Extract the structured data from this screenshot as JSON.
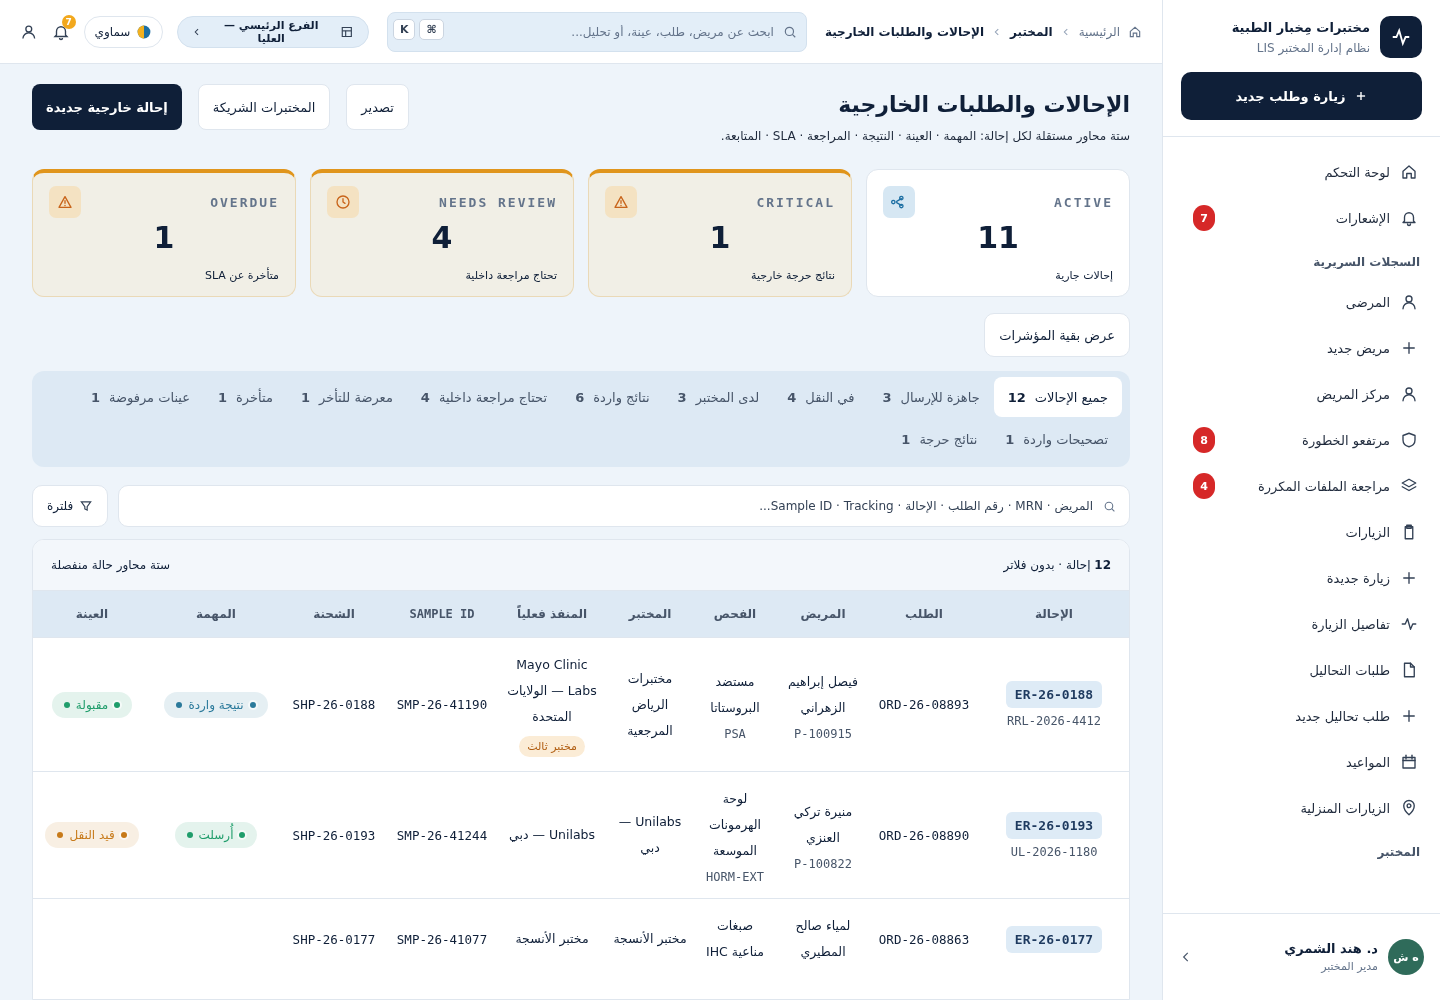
{
  "sidebar": {
    "brand": {
      "title": "مختبرات مِخبار الطبية",
      "subtitle": "نظام إدارة المختبر LIS"
    },
    "new_button": "زيارة وطلب جديد",
    "items": [
      {
        "kind": "link",
        "label": "لوحة التحكم",
        "selected": false
      },
      {
        "kind": "link",
        "label": "الإشعارات",
        "badge": "7",
        "selected": false
      },
      {
        "kind": "section",
        "label": "السجلات السريرية"
      },
      {
        "kind": "link",
        "label": "المرضى",
        "selected": false
      },
      {
        "kind": "link",
        "label": "مريض جديد",
        "selected": false
      },
      {
        "kind": "link",
        "label": "مركز المريض",
        "selected": false
      },
      {
        "kind": "link",
        "label": "مرتفعو الخطورة",
        "badge": "8",
        "selected": false
      },
      {
        "kind": "link",
        "label": "مراجعة الملفات المكررة",
        "badge": "4",
        "selected": false
      },
      {
        "kind": "link",
        "label": "الزيارات",
        "selected": false
      },
      {
        "kind": "link",
        "label": "زيارة جديدة",
        "selected": false
      },
      {
        "kind": "link",
        "label": "تفاصيل الزيارة",
        "selected": false
      },
      {
        "kind": "link",
        "label": "طلبات التحاليل",
        "selected": false
      },
      {
        "kind": "link",
        "label": "طلب تحاليل جديد",
        "selected": false
      },
      {
        "kind": "link",
        "label": "المواعيد",
        "selected": false
      },
      {
        "kind": "link",
        "label": "الزيارات المنزلية",
        "selected": false
      },
      {
        "kind": "section",
        "label": "المختبر"
      }
    ],
    "user": {
      "initials": "ه ش",
      "name": "د. هند الشمري",
      "role": "مدير المختبر"
    }
  },
  "topbar": {
    "breadcrumb": [
      "الرئيسية",
      "المختبر",
      "الإحالات والطلبات الخارجية"
    ],
    "search": {
      "placeholder": "ابحث عن مريض، طلب، عينة، أو تحليل..."
    },
    "shortcut": [
      "⌘",
      "K"
    ],
    "branch": "الفرع الرئيسي — العليا",
    "theme": "سماوي",
    "notifications": "7"
  },
  "page": {
    "title": "الإحالات والطلبات الخارجية",
    "subtitle": "ستة محاور مستقلة لكل إحالة: المهمة · العينة · النتيجة · المراجعة · SLA · المتابعة.",
    "buttons": [
      {
        "label": "تصدير",
        "kind": "outline"
      },
      {
        "label": "المختبرات الشريكة",
        "kind": "outline"
      },
      {
        "label": "إحالة خارجية جديدة",
        "kind": "primary"
      }
    ]
  },
  "kpis": [
    {
      "label": "ACTIVE",
      "value": "11",
      "caption": "إحالات جارية",
      "kind": "normal"
    },
    {
      "label": "CRITICAL",
      "value": "1",
      "caption": "نتائج حرجة خارجية",
      "kind": "warning"
    },
    {
      "label": "NEEDS REVIEW",
      "value": "4",
      "caption": "تحتاج مراجعة داخلية",
      "kind": "warning"
    },
    {
      "label": "OVERDUE",
      "value": "1",
      "caption": "متأخرة عن SLA",
      "kind": "warning"
    }
  ],
  "more_kpis": "عرض بقية المؤشرات",
  "tabs": [
    {
      "label": "جميع الإحالات",
      "count": "12",
      "selected": true
    },
    {
      "label": "جاهزة للإرسال",
      "count": "3",
      "selected": false
    },
    {
      "label": "في النقل",
      "count": "4",
      "selected": false
    },
    {
      "label": "لدى المختبر",
      "count": "3",
      "selected": false
    },
    {
      "label": "نتائج واردة",
      "count": "6",
      "selected": false
    },
    {
      "label": "تحتاج مراجعة داخلية",
      "count": "4",
      "selected": false
    },
    {
      "label": "معرضة للتأخر",
      "count": "1",
      "selected": false
    },
    {
      "label": "متأخرة",
      "count": "1",
      "selected": false
    },
    {
      "label": "عينات مرفوضة",
      "count": "1",
      "selected": false
    },
    {
      "label": "تصحيحات واردة",
      "count": "1",
      "selected": false
    },
    {
      "label": "نتائج حرجة",
      "count": "1",
      "selected": false
    }
  ],
  "filter": {
    "placeholder": "المريض · MRN · رقم الطلب · الإحالة · Sample ID · Tracking...",
    "button": "فلترة"
  },
  "table": {
    "summary": "**12** إحالة · بدون فلاتر",
    "note": "ستة محاور حالة منفصلة",
    "columns": [
      "الإحالة",
      "الطلب",
      "المريض",
      "الفحص",
      "المختبر",
      "المنفذ فعلياً",
      "SAMPLE ID",
      "الشحنة",
      "المهمة",
      "العينة"
    ],
    "rows": [
      {
        "referral": "ER-26-0188",
        "external_ref": "RRL-2026-4412",
        "order": "ORD-26-08893",
        "patient": "فيصل إبراهيم الزهراني",
        "mrn": "P-100915",
        "exam": "مستضد البروستاتا",
        "exam_code": "PSA",
        "lab": "مختبرات الرياض المرجعية",
        "performer": "Mayo Clinic Labs — الولايات المتحدة",
        "performer_tag": "مختبر ثالث",
        "sample_id": "SMP-26-41190",
        "shipment": "SHP-26-0188",
        "task": {
          "label": "نتيجة واردة",
          "color": "#2b7a9b"
        },
        "sample": {
          "label": "مقبولة",
          "color": "#1f9d6b"
        }
      },
      {
        "referral": "ER-26-0193",
        "external_ref": "UL-2026-1180",
        "order": "ORD-26-08890",
        "patient": "منيرة تركي العنزي",
        "mrn": "P-100822",
        "exam": "لوحة الهرمونات الموسعة",
        "exam_code": "HORM-EXT",
        "lab": "Unilabs — دبي",
        "performer": "Unilabs — دبي",
        "sample_id": "SMP-26-41244",
        "shipment": "SHP-26-0193",
        "task": {
          "label": "أُرسلت",
          "color": "#1f9d6b"
        },
        "sample": {
          "label": "قيد النقل",
          "color": "#c77a1a"
        }
      },
      {
        "referral": "ER-26-0177",
        "order": "ORD-26-08863",
        "patient": "لمياء صالح المطيري",
        "exam": "صبغات مناعية IHC",
        "lab": "مختبر الأنسجة",
        "performer": "مختبر الأنسجة",
        "sample_id": "SMP-26-41077",
        "shipment": "SHP-26-0177"
      }
    ]
  }
}
